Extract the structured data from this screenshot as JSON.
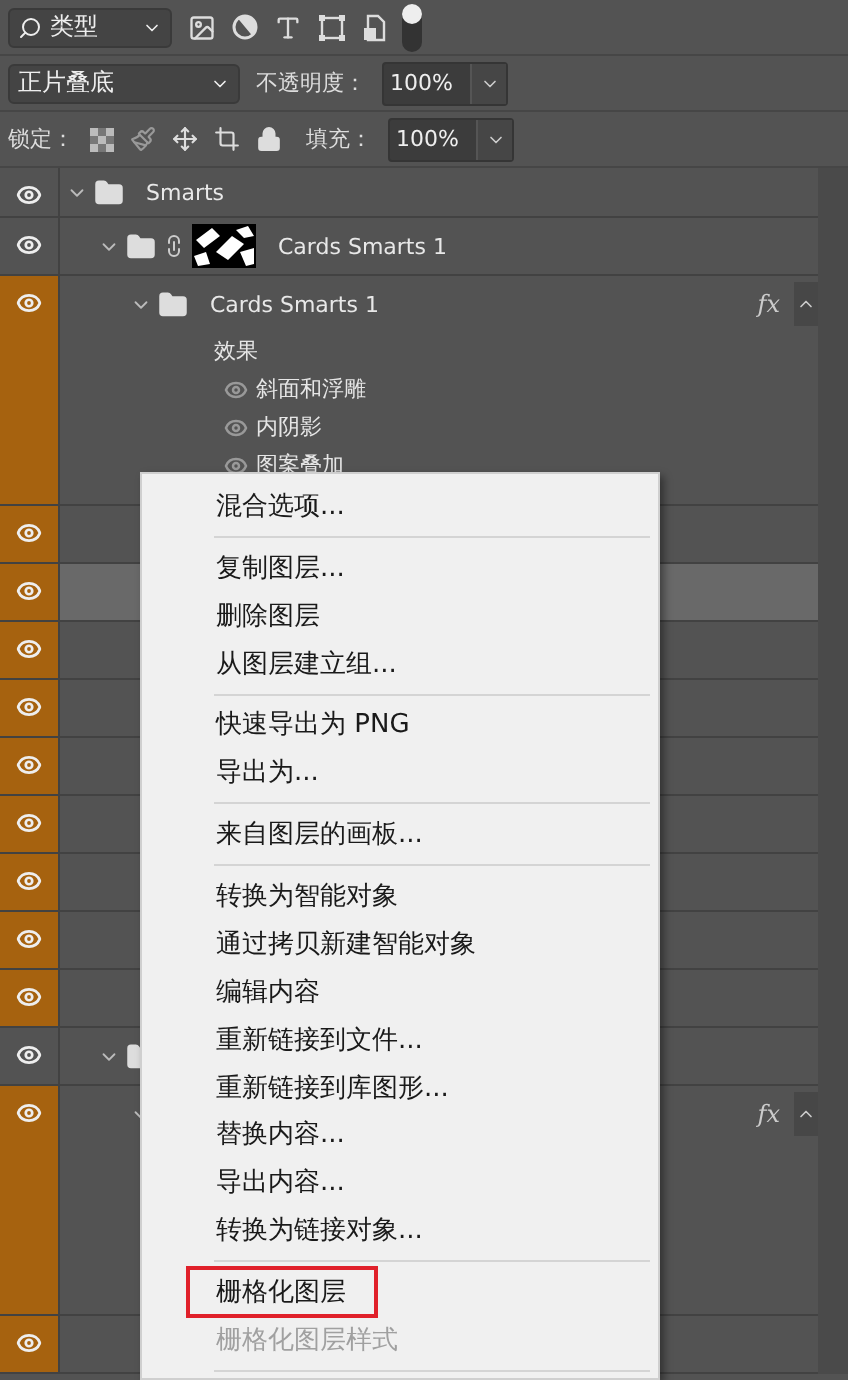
{
  "filter_bar": {
    "kind_dropdown": "类型",
    "filter_switch": {
      "on": true
    }
  },
  "blend_bar": {
    "mode": "正片叠底",
    "opacity_label": "不透明度：",
    "opacity": "100%"
  },
  "lock_bar": {
    "lock_label": "锁定：",
    "fill_label": "填充：",
    "fill": "100%"
  },
  "layers": [
    {
      "kind": "group",
      "name": "Smarts",
      "color": "#535353",
      "selected": false,
      "expanded": true,
      "children": [
        {
          "kind": "group",
          "name": "Cards Smarts 1",
          "color": "#535353",
          "selected": false,
          "expanded": true,
          "linked_mask": true,
          "children": [
            {
              "kind": "group",
              "name": "Cards Smarts 1",
              "color": "#a6620f",
              "selected": false,
              "expanded": true,
              "fx": "fx",
              "effects_shown": true,
              "effects_title": "效果",
              "effects": [
                {
                  "name": "斜面和浮雕"
                },
                {
                  "name": "内阴影"
                },
                {
                  "name": "图案叠加"
                }
              ]
            }
          ]
        },
        {
          "kind": "layer",
          "color": "#a6620f",
          "selected": false
        },
        {
          "kind": "layer",
          "color": "#a6620f",
          "selected": true
        },
        {
          "kind": "layer",
          "color": "#a6620f",
          "selected": false
        },
        {
          "kind": "layer",
          "color": "#a6620f",
          "selected": false
        },
        {
          "kind": "layer",
          "color": "#a6620f",
          "selected": false
        },
        {
          "kind": "layer",
          "color": "#a6620f",
          "selected": false
        },
        {
          "kind": "layer",
          "color": "#a6620f",
          "selected": false
        },
        {
          "kind": "layer",
          "color": "#a6620f",
          "selected": false
        },
        {
          "kind": "layer",
          "color": "#a6620f",
          "selected": false
        },
        {
          "kind": "group",
          "color": "#535353",
          "selected": false,
          "expanded": true,
          "children": [
            {
              "kind": "group",
              "color": "#a6620f",
              "selected": false,
              "expanded": true,
              "fx": "fx",
              "effects_shown": true
            }
          ]
        }
      ]
    },
    {
      "kind": "layer",
      "color": "#a6620f",
      "selected": false
    }
  ],
  "context_menu": [
    {
      "kind": "item",
      "label": "混合选项...",
      "disabled": false,
      "marked": false
    },
    {
      "kind": "separator"
    },
    {
      "kind": "item",
      "label": "复制图层...",
      "disabled": false,
      "marked": false
    },
    {
      "kind": "item",
      "label": "删除图层",
      "disabled": false,
      "marked": false
    },
    {
      "kind": "item",
      "label": "从图层建立组...",
      "disabled": false,
      "marked": false
    },
    {
      "kind": "separator"
    },
    {
      "kind": "item",
      "label": "快速导出为 PNG",
      "disabled": false,
      "marked": false
    },
    {
      "kind": "item",
      "label": "导出为...",
      "disabled": false,
      "marked": false
    },
    {
      "kind": "separator"
    },
    {
      "kind": "item",
      "label": "来自图层的画板...",
      "disabled": false,
      "marked": false
    },
    {
      "kind": "separator"
    },
    {
      "kind": "item",
      "label": "转换为智能对象",
      "disabled": false,
      "marked": false
    },
    {
      "kind": "item",
      "label": "通过拷贝新建智能对象",
      "disabled": false,
      "marked": false
    },
    {
      "kind": "item",
      "label": "编辑内容",
      "disabled": false,
      "marked": false
    },
    {
      "kind": "item",
      "label": "重新链接到文件...",
      "disabled": false,
      "marked": false
    },
    {
      "kind": "item",
      "label": "重新链接到库图形...",
      "disabled": false,
      "marked": false
    },
    {
      "kind": "item",
      "label": "替换内容...",
      "disabled": false,
      "marked": false
    },
    {
      "kind": "item",
      "label": "导出内容...",
      "disabled": false,
      "marked": false
    },
    {
      "kind": "item",
      "label": "转换为链接对象...",
      "disabled": false,
      "marked": false
    },
    {
      "kind": "separator"
    },
    {
      "kind": "item",
      "label": "栅格化图层",
      "disabled": false,
      "marked": true
    },
    {
      "kind": "item",
      "label": "栅格化图层样式",
      "disabled": true,
      "marked": false
    },
    {
      "kind": "separator"
    }
  ]
}
